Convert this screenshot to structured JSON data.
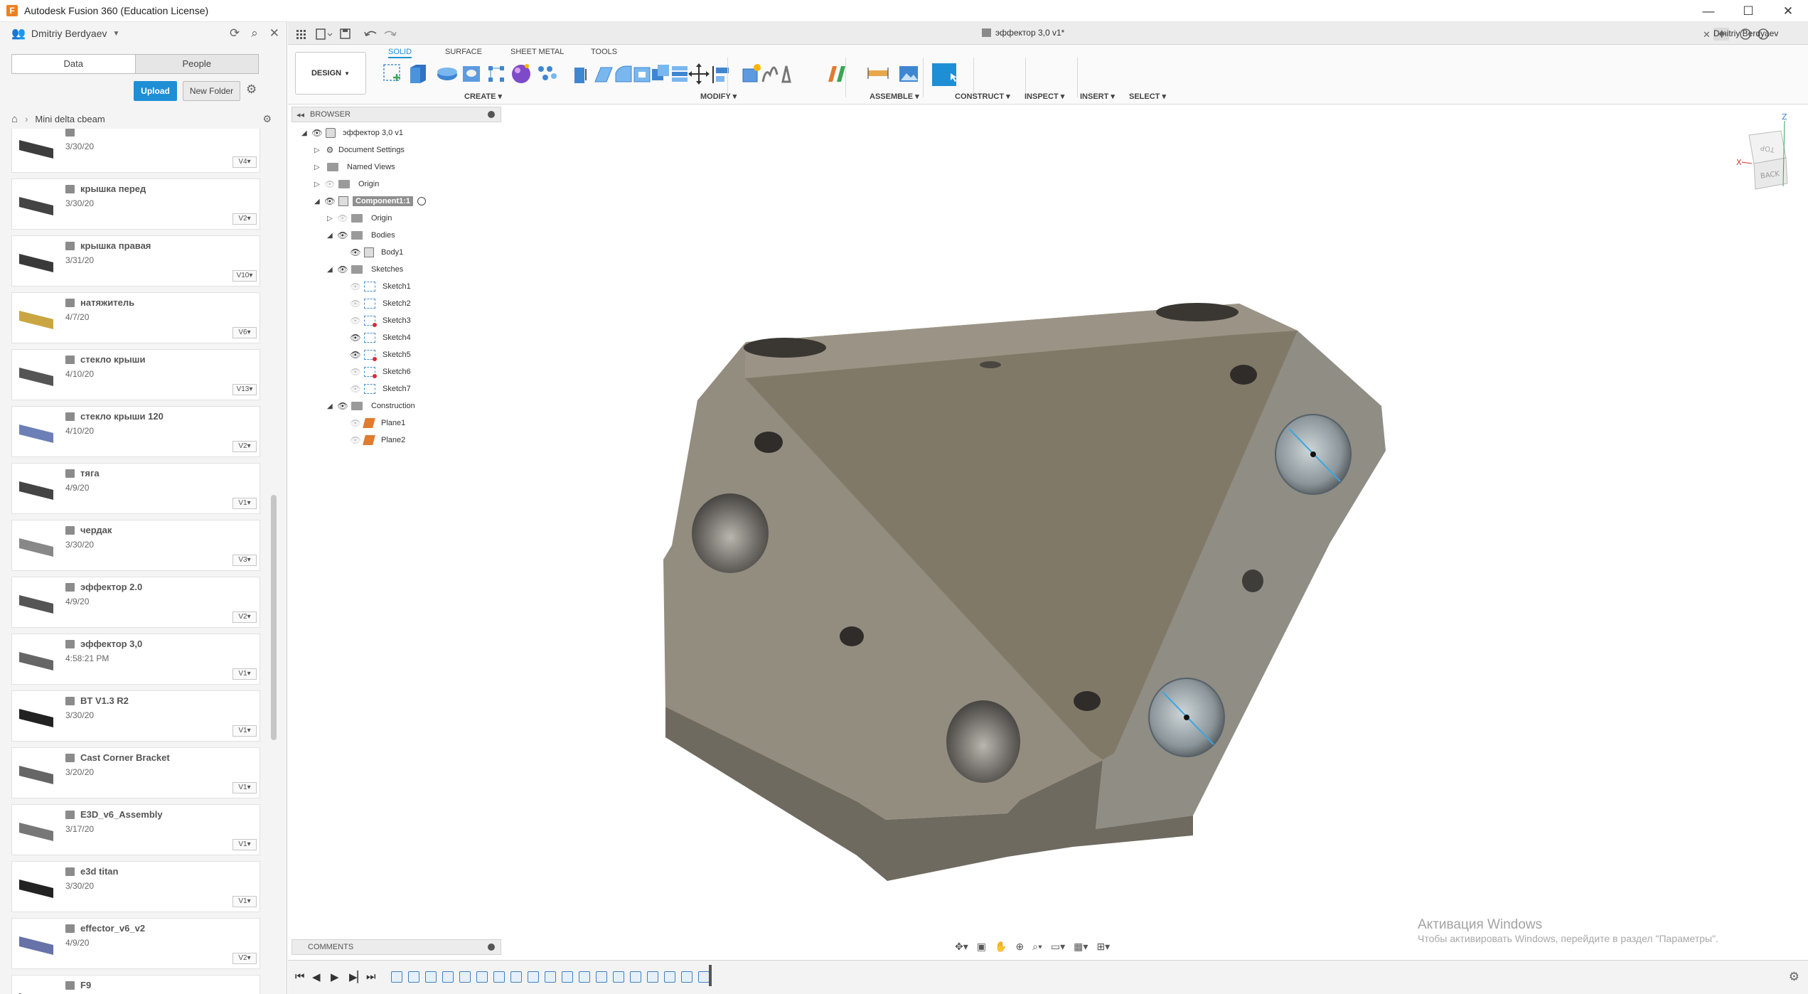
{
  "window": {
    "title": "Autodesk Fusion 360 (Education License)",
    "minimize": "—",
    "maximize": "☐",
    "close": "✕"
  },
  "data_panel": {
    "user": "Dmitriy Berdyaev",
    "tabs": [
      {
        "label": "Data",
        "active": true
      },
      {
        "label": "People",
        "active": false
      }
    ],
    "upload_label": "Upload",
    "new_folder_label": "New Folder",
    "breadcrumb": "Mini delta cbeam",
    "files": [
      {
        "name": "",
        "date": "3/30/20",
        "version": "V4"
      },
      {
        "name": "крышка перед",
        "date": "3/30/20",
        "version": "V2"
      },
      {
        "name": "крышка правая",
        "date": "3/31/20",
        "version": "V10"
      },
      {
        "name": "натяжитель",
        "date": "4/7/20",
        "version": "V6"
      },
      {
        "name": "стекло крыши",
        "date": "4/10/20",
        "version": "V13"
      },
      {
        "name": "стекло крыши 120",
        "date": "4/10/20",
        "version": "V2"
      },
      {
        "name": "тяга",
        "date": "4/9/20",
        "version": "V1"
      },
      {
        "name": "чердак",
        "date": "3/30/20",
        "version": "V3"
      },
      {
        "name": "эффектор 2.0",
        "date": "4/9/20",
        "version": "V2"
      },
      {
        "name": "эффектор 3,0",
        "date": "4:58:21 PM",
        "version": "V1"
      },
      {
        "name": "BT V1.3 R2",
        "date": "3/30/20",
        "version": "V1"
      },
      {
        "name": "Cast Corner Bracket",
        "date": "3/20/20",
        "version": "V1"
      },
      {
        "name": "E3D_v6_Assembly",
        "date": "3/17/20",
        "version": "V1"
      },
      {
        "name": "e3d titan",
        "date": "3/30/20",
        "version": "V1"
      },
      {
        "name": "effector_v6_v2",
        "date": "4/9/20",
        "version": "V2"
      },
      {
        "name": "F9",
        "date": "",
        "version": ""
      }
    ]
  },
  "document": {
    "tab_title": "эффектор 3,0 v1*",
    "user": "Dmitriy Berdyaev"
  },
  "toolbar": {
    "design_label": "DESIGN",
    "workspace_tabs": [
      "SOLID",
      "SURFACE",
      "SHEET METAL",
      "TOOLS"
    ],
    "groups": [
      "CREATE",
      "MODIFY",
      "ASSEMBLE",
      "CONSTRUCT",
      "INSPECT",
      "INSERT",
      "SELECT"
    ]
  },
  "browser": {
    "header": "BROWSER",
    "root": "эффектор 3,0 v1",
    "items": {
      "document_settings": "Document Settings",
      "named_views": "Named Views",
      "origin": "Origin",
      "component": "Component1:1",
      "comp_origin": "Origin",
      "bodies": "Bodies",
      "body1": "Body1",
      "sketches": "Sketches",
      "sketch1": "Sketch1",
      "sketch2": "Sketch2",
      "sketch3": "Sketch3",
      "sketch4": "Sketch4",
      "sketch5": "Sketch5",
      "sketch6": "Sketch6",
      "sketch7": "Sketch7",
      "construction": "Construction",
      "plane1": "Plane1",
      "plane2": "Plane2"
    }
  },
  "viewcube": {
    "face_top": "TOP",
    "face_back": "BACK",
    "axis_x": "X",
    "axis_z": "Z"
  },
  "comments_label": "COMMENTS",
  "activation": {
    "title": "Активация Windows",
    "text": "Чтобы активировать Windows, перейдите в раздел \"Параметры\"."
  },
  "colors": {
    "accent": "#1f8fd5",
    "part_top": "#807868",
    "part_left": "#918b7d",
    "part_right": "#8e8c82"
  }
}
